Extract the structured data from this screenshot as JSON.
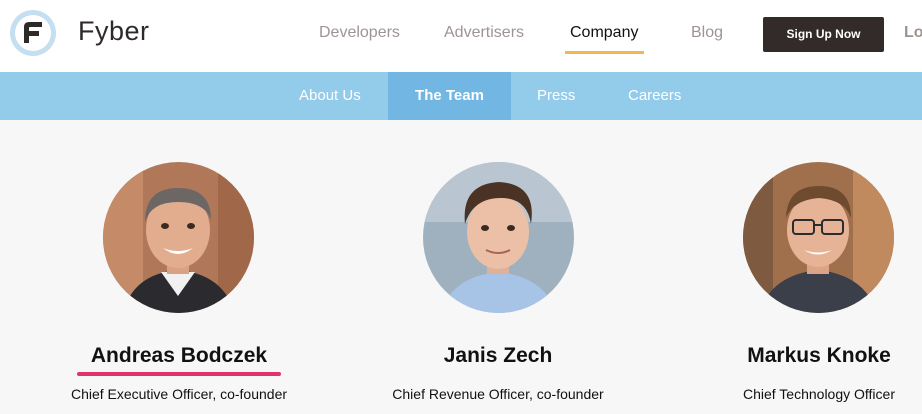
{
  "brand": {
    "name": "Fyber",
    "logo_icon": "fyber-f-logo-icon"
  },
  "nav": {
    "items": [
      {
        "label": "Developers",
        "active": false
      },
      {
        "label": "Advertisers",
        "active": false
      },
      {
        "label": "Company",
        "active": true
      },
      {
        "label": "Blog",
        "active": false
      }
    ],
    "signup_label": "Sign Up Now",
    "login_label_visible": "Lo"
  },
  "subnav": {
    "items": [
      {
        "label": "About Us",
        "active": false
      },
      {
        "label": "The Team",
        "active": true
      },
      {
        "label": "Press",
        "active": false
      },
      {
        "label": "Careers",
        "active": false
      }
    ]
  },
  "team": [
    {
      "name": "Andreas Bodczek",
      "role": "Chief Executive Officer, co-founder",
      "highlighted": true
    },
    {
      "name": "Janis Zech",
      "role": "Chief Revenue Officer, co-founder",
      "highlighted": false
    },
    {
      "name": "Markus Knoke",
      "role": "Chief Technology Officer",
      "highlighted": false
    }
  ],
  "colors": {
    "subnav_bg": "#93cbea",
    "subnav_active_bg": "#72b6e3",
    "nav_active_underline": "#f0b84d",
    "signup_bg": "#332a2a",
    "name_highlight_underline": "#e0326c",
    "team_bg": "#f7f7f7"
  }
}
